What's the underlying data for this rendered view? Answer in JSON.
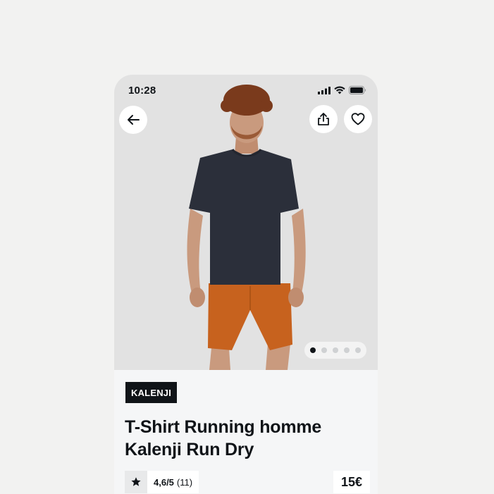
{
  "status_bar": {
    "time": "10:28"
  },
  "nav": {
    "back_icon": "arrow-left-icon",
    "share_icon": "share-icon",
    "favorite_icon": "heart-icon"
  },
  "gallery": {
    "total": 5,
    "active": 1
  },
  "product": {
    "brand": "KALENJI",
    "title_line1": "T-Shirt Running homme",
    "title_line2": "Kalenji Run Dry",
    "rating_score": "4,6/5",
    "rating_count": "(11)",
    "price": "15€"
  },
  "colors": {
    "background": "#f2f2f1",
    "hero": "#e2e2e2",
    "ink": "#101418",
    "shirt": "#2b2f3a",
    "shorts": "#c7621e"
  }
}
